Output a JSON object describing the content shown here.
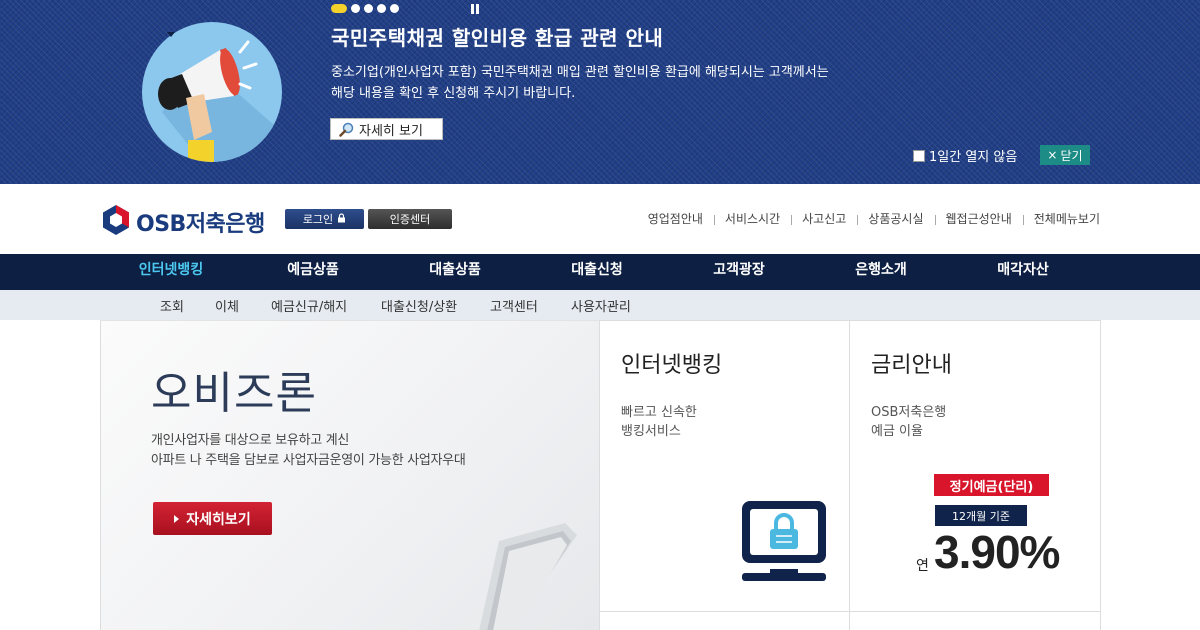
{
  "popup": {
    "title": "국민주택채권 할인비용 환급 관련 안내",
    "desc_line1": "중소기업(개인사업자 포함) 국민주택채권 매입 관련 할인비용 환급에 해당되시는 고객께서는",
    "desc_line2": "해당 내용을 확인 후 신청해 주시기 바랍니다.",
    "detail_label": "자세히 보기",
    "no_open_label": "1일간 열지 않음",
    "close_label": "닫기",
    "close_icon": "×",
    "slide_count": 5,
    "active_slide": 1
  },
  "header": {
    "logo_text": "OSB저축은행",
    "login_label": "로그인",
    "cert_label": "인증센터",
    "util_links": [
      "영업점안내",
      "서비스시간",
      "사고신고",
      "상품공시실",
      "웹접근성안내",
      "전체메뉴보기"
    ]
  },
  "gnb": {
    "items": [
      "인터넷뱅킹",
      "예금상품",
      "대출상품",
      "대출신청",
      "고객광장",
      "은행소개",
      "매각자산"
    ],
    "active": 0
  },
  "snb": {
    "items": [
      "조회",
      "이체",
      "예금신규/해지",
      "대출신청/상환",
      "고객센터",
      "사용자관리"
    ]
  },
  "hero": {
    "title": "오비즈론",
    "desc_line1": "개인사업자를 대상으로 보유하고 계신",
    "desc_line2": "아파트 나 주택을 담보로 사업자금운영이 가능한 사업자우대",
    "button_label": "자세히보기"
  },
  "internet_banking": {
    "title": "인터넷뱅킹",
    "desc_line1": "빠르고 신속한",
    "desc_line2": "뱅킹서비스"
  },
  "rate": {
    "title": "금리안내",
    "desc_line1": "OSB저축은행",
    "desc_line2": "예금 이율",
    "badge_product": "정기예금(단리)",
    "badge_term": "12개월 기준",
    "prefix": "연",
    "value": "3.90%"
  },
  "colors": {
    "popup_bg": "#213f86",
    "gnb_bg": "#0d2043",
    "gnb_active": "#4cc8f0",
    "accent_red": "#d8152a",
    "close_teal": "#1e8c86"
  }
}
